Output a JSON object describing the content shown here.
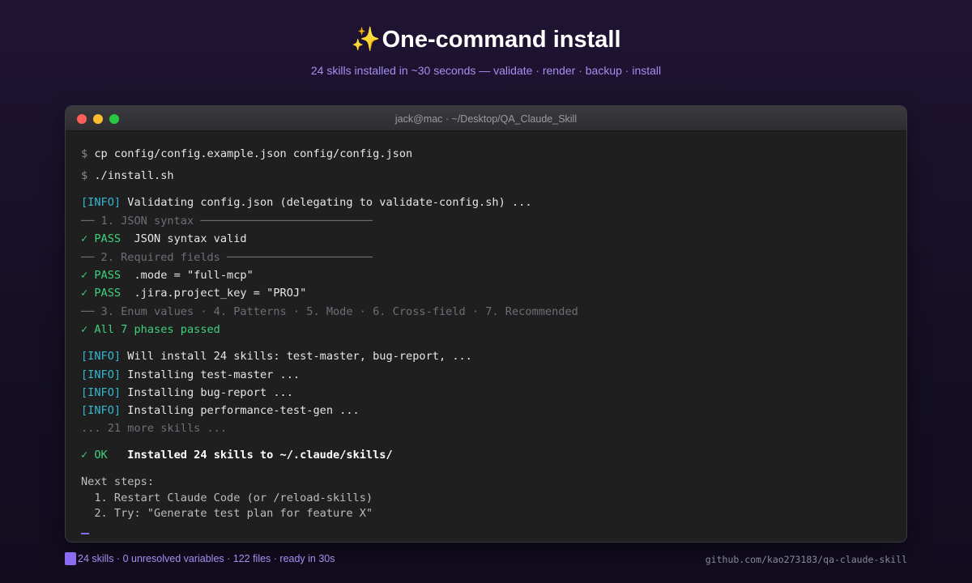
{
  "hero": {
    "title": "One-command install",
    "sparkle": "✨",
    "subtitle": "24 skills installed in ~30 seconds — validate · render · backup · install"
  },
  "terminal": {
    "window_title": "jack@mac · ~/Desktop/QA_Claude_Skill",
    "prompt_symbol": "$",
    "cmd1": "cp config/config.example.json config/config.json",
    "cmd2": "./install.sh",
    "info_tag": "[INFO]",
    "validating": " Validating config.json (delegating to validate-config.sh) ...",
    "section1": "── 1. JSON syntax ──────────────────────────",
    "pass_tag": "✓ PASS",
    "pass1": "  JSON syntax valid",
    "section2": "── 2. Required fields ──────────────────────",
    "pass2": "  .mode = \"full-mcp\"",
    "pass3": "  .jira.project_key = \"PROJ\"",
    "section3": "── 3. Enum values · 4. Patterns · 5. Mode · 6. Cross-field · 7. Recommended",
    "all_passed": "✓ All 7 phases passed",
    "will_install": " Will install 24 skills: test-master, bug-report, ...",
    "installing1": " Installing test-master ...",
    "installing2": " Installing bug-report ...",
    "installing3": " Installing performance-test-gen ...",
    "more_skills": "... 21 more skills ...",
    "ok_tag": "✓ OK",
    "ok_text": "   Installed 24 skills to ~/.claude/skills/",
    "next_steps": "Next steps:",
    "step1": "  1. Restart Claude Code (or /reload-skills)",
    "step2": "  2. Try: \"Generate test plan for feature X\""
  },
  "footer": {
    "stats": "24 skills · 0 unresolved variables · 122 files · ready in 30s",
    "repo": "github.com/kao273183/qa-claude-skill"
  },
  "colors": {
    "accent": "#8b6cf0",
    "info": "#33b8d0",
    "pass": "#3ed17c"
  }
}
